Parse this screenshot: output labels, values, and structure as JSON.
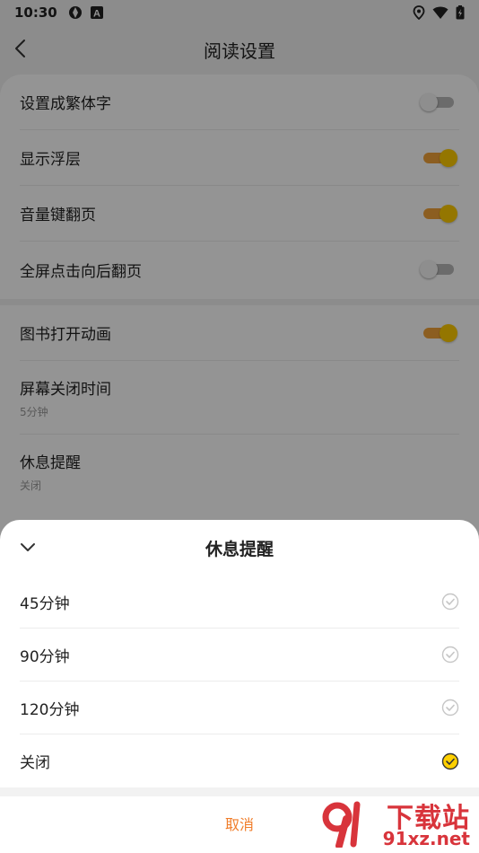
{
  "status_bar": {
    "time": "10:30"
  },
  "header": {
    "title": "阅读设置"
  },
  "settings_group1": [
    {
      "label": "设置成繁体字",
      "toggle": "off"
    },
    {
      "label": "显示浮层",
      "toggle": "on"
    },
    {
      "label": "音量键翻页",
      "toggle": "on"
    },
    {
      "label": "全屏点击向后翻页",
      "toggle": "off"
    }
  ],
  "settings_group2": {
    "book_anim": {
      "label": "图书打开动画",
      "toggle": "on"
    },
    "screen_off": {
      "label": "屏幕关闭时间",
      "value": "5分钟"
    },
    "rest_reminder": {
      "label": "休息提醒",
      "value": "关闭"
    }
  },
  "sheet": {
    "title": "休息提醒",
    "options": [
      {
        "label": "45分钟",
        "selected": false
      },
      {
        "label": "90分钟",
        "selected": false
      },
      {
        "label": "120分钟",
        "selected": false
      },
      {
        "label": "关闭",
        "selected": true
      }
    ],
    "cancel_label": "取消"
  },
  "watermark": {
    "line1": "下载站",
    "line2": "91xz.net"
  },
  "colors": {
    "accent": "#f07d2a",
    "toggle_on_track": "#f2a33a",
    "toggle_on_knob": "#ffcc00",
    "check_selected": "#ffd000"
  }
}
